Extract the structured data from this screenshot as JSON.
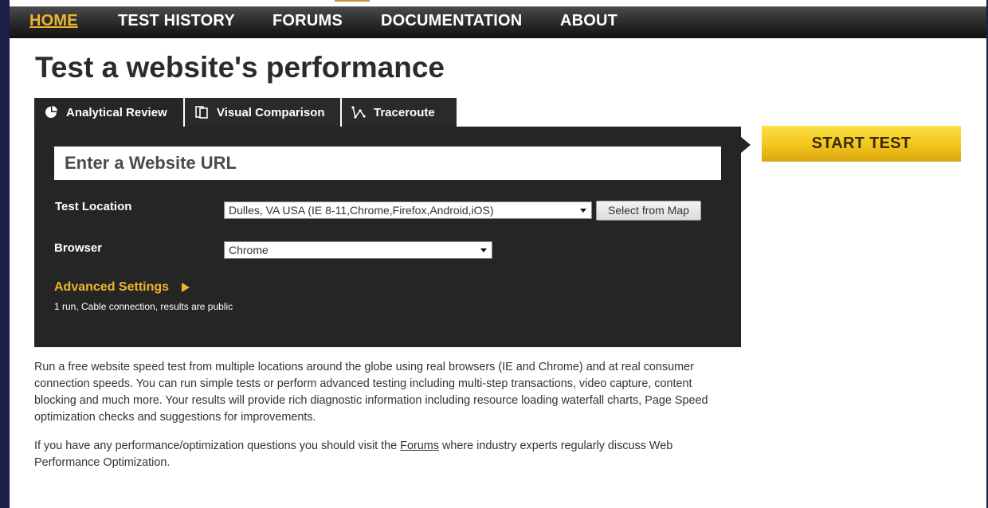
{
  "nav": {
    "items": [
      "HOME",
      "TEST HISTORY",
      "FORUMS",
      "DOCUMENTATION",
      "ABOUT"
    ],
    "active": "HOME"
  },
  "page_title": "Test a website's performance",
  "tabs": [
    {
      "label": "Analytical Review",
      "icon": "pie-chart-icon",
      "active": true
    },
    {
      "label": "Visual Comparison",
      "icon": "compare-pages-icon",
      "active": false
    },
    {
      "label": "Traceroute",
      "icon": "traceroute-icon",
      "active": false
    }
  ],
  "form": {
    "url_placeholder": "Enter a Website URL",
    "location_label": "Test Location",
    "location_value": "Dulles, VA USA (IE 8-11,Chrome,Firefox,Android,iOS)",
    "select_from_map": "Select from Map",
    "browser_label": "Browser",
    "browser_value": "Chrome",
    "advanced_settings": "Advanced Settings",
    "advanced_summary": "1 run, Cable connection, results are public"
  },
  "start_test": "START TEST",
  "description": {
    "p1": "Run a free website speed test from multiple locations around the globe using real browsers (IE and Chrome) and at real consumer connection speeds. You can run simple tests or perform advanced testing including multi-step transactions, video capture, content blocking and much more. Your results will provide rich diagnostic information including resource loading waterfall charts, Page Speed optimization checks and suggestions for improvements.",
    "p2_before": "If you have any performance/optimization questions you should visit the ",
    "p2_link": "Forums",
    "p2_after": " where industry experts regularly discuss Web Performance Optimization."
  },
  "colors": {
    "accent": "#f0b52a",
    "panel": "#252525",
    "page_frame": "#1c2048"
  }
}
